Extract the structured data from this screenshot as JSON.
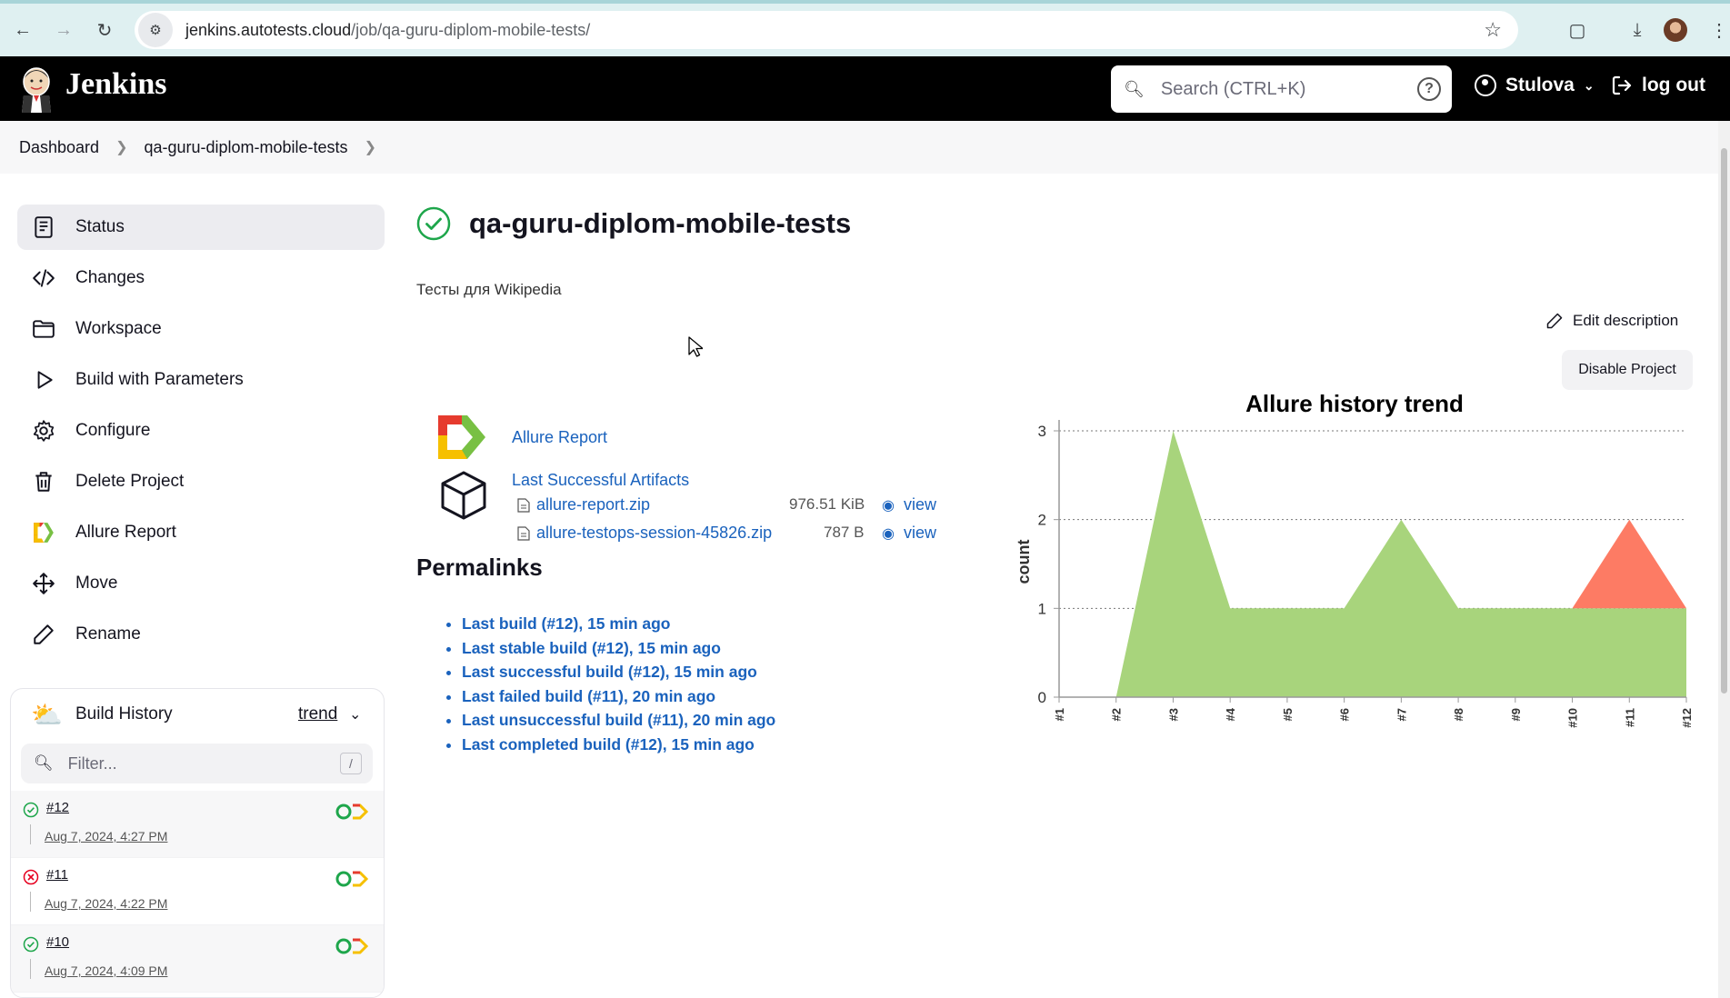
{
  "browser": {
    "url_host": "jenkins.autotests.cloud",
    "url_path": "/job/qa-guru-diplom-mobile-tests/"
  },
  "header": {
    "app_name": "Jenkins",
    "search_placeholder": "Search (CTRL+K)",
    "user_name": "Stulova",
    "logout_label": "log out"
  },
  "breadcrumb": [
    "Dashboard",
    "qa-guru-diplom-mobile-tests"
  ],
  "sidebar": {
    "items": [
      {
        "label": "Status",
        "icon": "status-icon"
      },
      {
        "label": "Changes",
        "icon": "code-icon"
      },
      {
        "label": "Workspace",
        "icon": "folder-icon"
      },
      {
        "label": "Build with Parameters",
        "icon": "play-icon"
      },
      {
        "label": "Configure",
        "icon": "gear-icon"
      },
      {
        "label": "Delete Project",
        "icon": "trash-icon"
      },
      {
        "label": "Allure Report",
        "icon": "allure-icon"
      },
      {
        "label": "Move",
        "icon": "move-icon"
      },
      {
        "label": "Rename",
        "icon": "pencil-icon"
      }
    ]
  },
  "build_history": {
    "title": "Build History",
    "trend_label": "trend",
    "filter_placeholder": "Filter...",
    "filter_shortcut": "/",
    "builds": [
      {
        "number": "#12",
        "date": "Aug 7, 2024, 4:27 PM",
        "status": "success"
      },
      {
        "number": "#11",
        "date": "Aug 7, 2024, 4:22 PM",
        "status": "failed"
      },
      {
        "number": "#10",
        "date": "Aug 7, 2024, 4:09 PM",
        "status": "success"
      }
    ]
  },
  "job": {
    "title": "qa-guru-diplom-mobile-tests",
    "description": "Тесты для Wikipedia",
    "edit_description_label": "Edit description",
    "disable_label": "Disable Project",
    "allure_report_label": "Allure Report",
    "artifacts_label": "Last Successful Artifacts",
    "artifacts": [
      {
        "name": "allure-report.zip",
        "size": "976.51 KiB",
        "view": "view"
      },
      {
        "name": "allure-testops-session-45826.zip",
        "size": "787 B",
        "view": "view"
      }
    ],
    "permalinks_title": "Permalinks",
    "permalinks": [
      "Last build (#12), 15 min ago",
      "Last stable build (#12), 15 min ago",
      "Last successful build (#12), 15 min ago",
      "Last failed build (#11), 20 min ago",
      "Last unsuccessful build (#11), 20 min ago",
      "Last completed build (#12), 15 min ago"
    ]
  },
  "chart_data": {
    "type": "area",
    "title": "Allure history trend",
    "xlabel": "",
    "ylabel": "count",
    "categories": [
      "#1",
      "#2",
      "#3",
      "#4",
      "#5",
      "#6",
      "#7",
      "#8",
      "#9",
      "#10",
      "#11",
      "#12"
    ],
    "ylim": [
      0,
      3
    ],
    "yticks": [
      0,
      1,
      2,
      3
    ],
    "grid": true,
    "stacked": true,
    "series": [
      {
        "values": [
          0,
          0,
          3,
          1,
          1,
          1,
          2,
          1,
          1,
          1,
          1,
          1
        ],
        "color": "#a8d47c"
      },
      {
        "values": [
          0,
          0,
          0,
          0,
          0,
          0,
          0,
          0,
          0,
          0,
          1,
          0
        ],
        "color": "#fd7b64"
      }
    ]
  }
}
